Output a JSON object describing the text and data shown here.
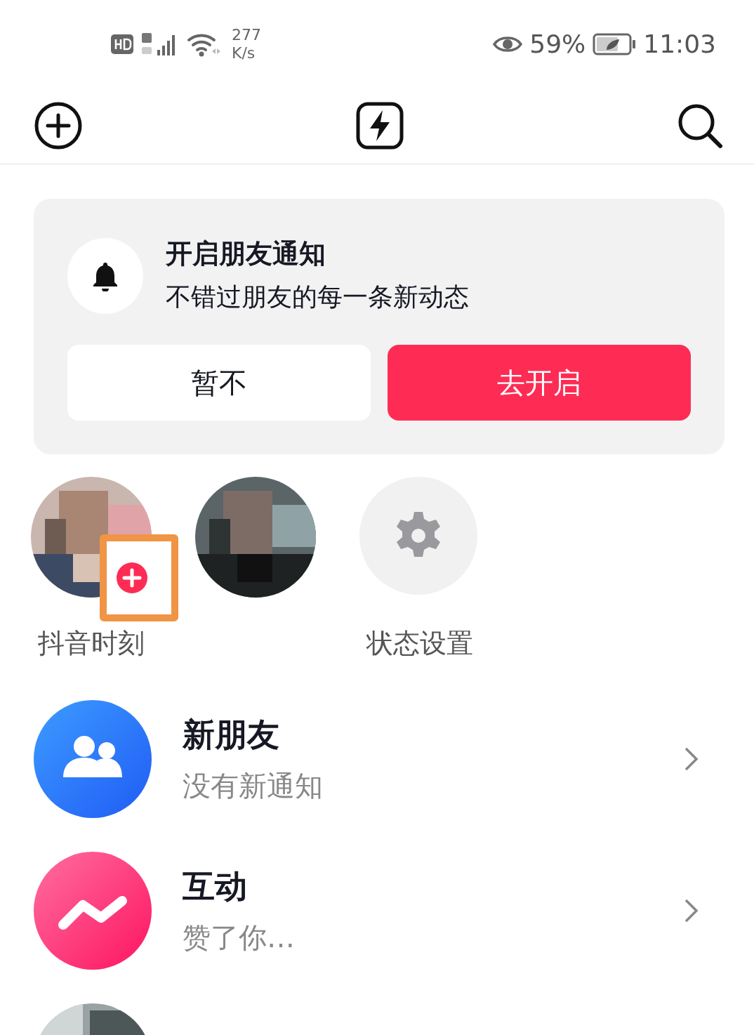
{
  "status_bar": {
    "speed_value": "277",
    "speed_unit": "K/s",
    "battery": "59%",
    "time": "11:03"
  },
  "notice": {
    "title": "开启朋友通知",
    "subtitle": "不错过朋友的每一条新动态",
    "buttons": [
      {
        "label": "暂不",
        "kind": "secondary"
      },
      {
        "label": "去开启",
        "kind": "primary"
      }
    ]
  },
  "stories": [
    {
      "kind": "picture",
      "label": "抖音时刻",
      "add_button": true,
      "highlighted": true
    },
    {
      "kind": "picture"
    },
    {
      "kind": "settings",
      "label": "状态设置"
    }
  ],
  "messages": [
    {
      "kind": "friends",
      "title": "新朋友",
      "subtitle": "没有新通知"
    },
    {
      "kind": "interaction",
      "title": "互动",
      "subtitle": "赞了你…"
    },
    {
      "kind": "picture"
    }
  ]
}
